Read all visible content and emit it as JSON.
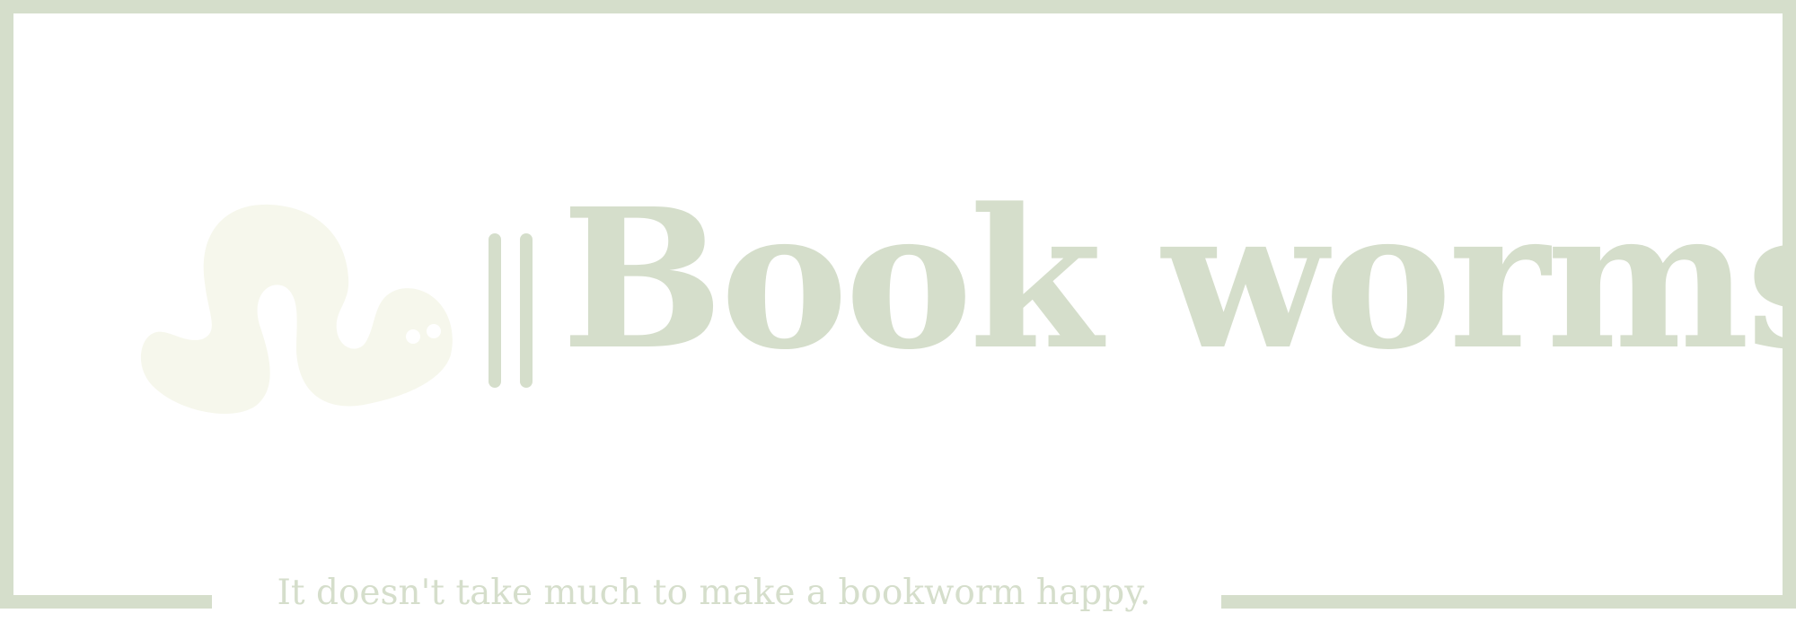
{
  "brand": {
    "name": "Book worms",
    "tagline": "It doesn't take much to make a bookworm happy."
  },
  "colors": {
    "frame": "#d5decb",
    "text": "#d5decb",
    "worm_body": "#f6f7ec",
    "worm_eyes": "#ffffff",
    "background": "#ffffff"
  },
  "icons": {
    "logo": "bookworm-icon",
    "divider": "double-bar-icon"
  }
}
